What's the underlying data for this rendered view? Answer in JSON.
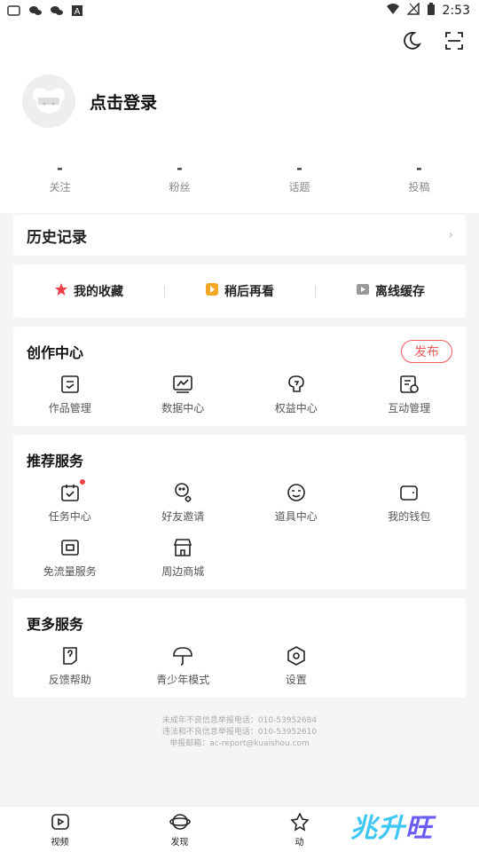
{
  "status_bar": {
    "time": "2:53"
  },
  "profile": {
    "login_text": "点击登录"
  },
  "stats": [
    {
      "value": "-",
      "label": "关注"
    },
    {
      "value": "-",
      "label": "粉丝"
    },
    {
      "value": "-",
      "label": "话题"
    },
    {
      "value": "-",
      "label": "投稿"
    }
  ],
  "history": {
    "title": "历史记录"
  },
  "quick_links": [
    {
      "label": "我的收藏",
      "icon": "star-icon",
      "color": "#f0404a"
    },
    {
      "label": "稍后再看",
      "icon": "play-clock-icon",
      "color": "#f5a623"
    },
    {
      "label": "离线缓存",
      "icon": "download-icon",
      "color": "#999999"
    }
  ],
  "creation_center": {
    "title": "创作中心",
    "publish_label": "发布",
    "items": [
      {
        "label": "作品管理",
        "icon": "works-icon"
      },
      {
        "label": "数据中心",
        "icon": "chart-icon"
      },
      {
        "label": "权益中心",
        "icon": "rights-icon"
      },
      {
        "label": "互动管理",
        "icon": "interact-icon"
      }
    ]
  },
  "recommended": {
    "title": "推荐服务",
    "items": [
      {
        "label": "任务中心",
        "icon": "task-icon",
        "badge": true
      },
      {
        "label": "好友邀请",
        "icon": "friend-invite-icon"
      },
      {
        "label": "道具中心",
        "icon": "mask-icon"
      },
      {
        "label": "我的钱包",
        "icon": "wallet-icon"
      },
      {
        "label": "免流量服务",
        "icon": "sim-icon"
      },
      {
        "label": "周边商城",
        "icon": "shop-icon"
      }
    ]
  },
  "more": {
    "title": "更多服务",
    "items": [
      {
        "label": "反馈帮助",
        "icon": "feedback-icon"
      },
      {
        "label": "青少年模式",
        "icon": "umbrella-icon"
      },
      {
        "label": "设置",
        "icon": "settings-icon"
      }
    ]
  },
  "footer": {
    "line1": "未成年不良信息举报电话：010-53952684",
    "line2": "违法和不良信息举报电话：010-53952610",
    "line3": "举报邮箱：ac-report@kuaishou.com"
  },
  "tabs": [
    {
      "label": "视频",
      "icon": "video-tab-icon"
    },
    {
      "label": "发现",
      "icon": "discover-tab-icon"
    },
    {
      "label": "动",
      "icon": "dynamic-tab-icon"
    }
  ],
  "brand": {
    "part1": "兆升",
    "part2": "旺"
  }
}
